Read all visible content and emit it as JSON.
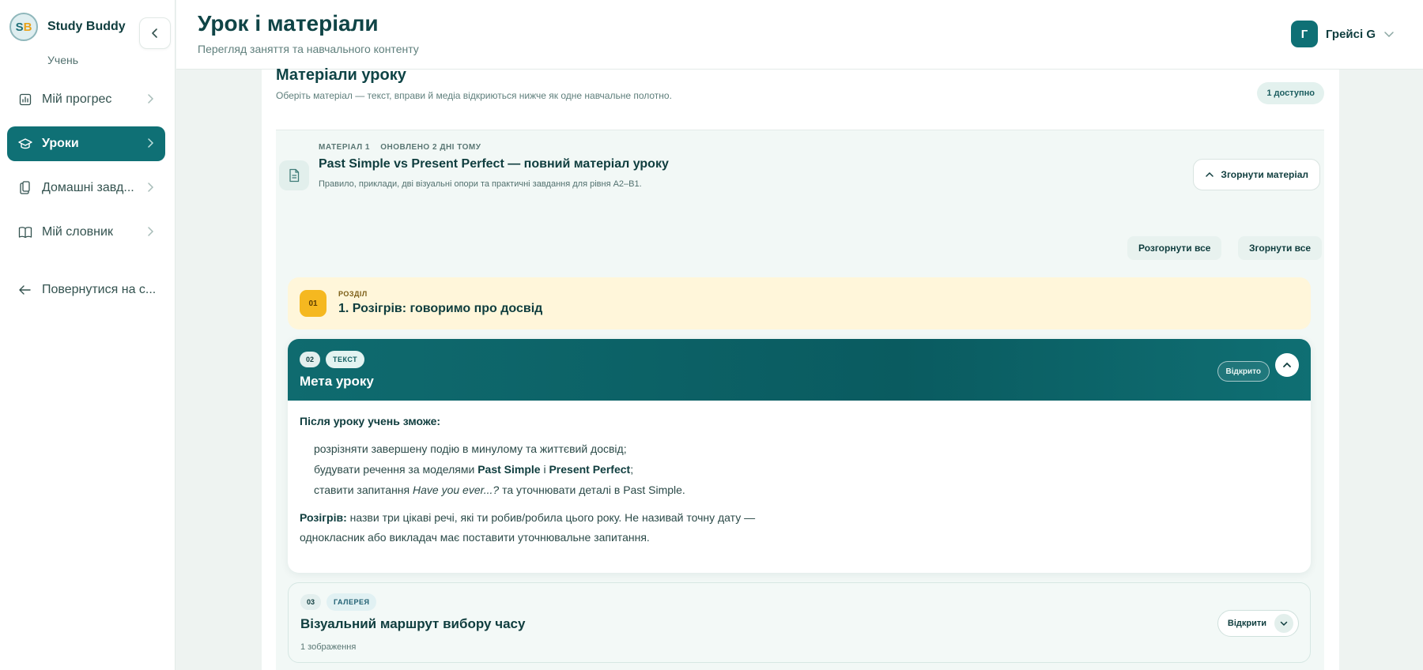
{
  "app": {
    "name": "Study Buddy",
    "role": "Учень"
  },
  "sidebar": {
    "items": [
      {
        "label": "Мій прогрес",
        "icon": "chart-icon"
      },
      {
        "label": "Уроки",
        "icon": "graduation-cap-icon",
        "active": true
      },
      {
        "label": "Домашні завд...",
        "icon": "clipboard-icon"
      },
      {
        "label": "Мій словник",
        "icon": "book-icon"
      }
    ],
    "back_label": "Повернутися на с..."
  },
  "header": {
    "title": "Урок і матеріали",
    "subtitle": "Перегляд заняття та навчального контенту",
    "user_initial": "Г",
    "user_name": "Грейсі G"
  },
  "materials": {
    "title": "Матеріали уроку",
    "subtitle": "Оберіть матеріал — текст, вправи й медіа відкриються нижче як одне навчальне полотно.",
    "available_badge": "1 доступно",
    "material": {
      "index_label": "МАТЕРІАЛ 1",
      "updated_label": "ОНОВЛЕНО 2 ДНІ ТОМУ",
      "title": "Past Simple vs Present Perfect — повний матеріал уроку",
      "description": "Правило, приклади, дві візуальні опори та практичні завдання для рівня A2–B1.",
      "collapse_label": "Згорнути матеріал",
      "expand_all_label": "Розгорнути все",
      "collapse_all_label": "Згорнути все"
    },
    "section": {
      "number": "01",
      "label": "РОЗДІЛ",
      "title": "1. Розігрів: говоримо про досвід"
    },
    "item_open": {
      "number": "02",
      "type": "ТЕКСТ",
      "title": "Мета уроку",
      "status": "Відкрито",
      "lead": "Після уроку учень зможе:",
      "goal1": "розрізняти завершену подію в минулому та життєвий досвід;",
      "goal2_pre": "будувати речення за моделями ",
      "goal2_b1": "Past Simple",
      "goal2_mid": " і ",
      "goal2_b2": "Present Perfect",
      "goal2_post": ";",
      "goal3_pre": "ставити запитання ",
      "goal3_em": "Have you ever...?",
      "goal3_post": " та уточнювати деталі в Past Simple.",
      "warmup_label": "Розігрів:",
      "warmup_text": " назви три цікаві речі, які ти робив/робила цього року. Не називай точну дату — однокласник або викладач має поставити уточнювальне запитання."
    },
    "item_closed": {
      "number": "03",
      "type": "ГАЛЕРЕЯ",
      "title": "Візуальний маршрут вибору часу",
      "count": "1 зображення",
      "open_label": "Відкрити"
    }
  }
}
